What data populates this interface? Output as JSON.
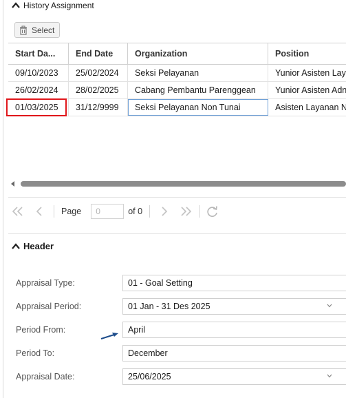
{
  "history": {
    "title": "History Assignment",
    "select_label": "Select",
    "columns": [
      "Start Da...",
      "End Date",
      "Organization",
      "Position"
    ],
    "rows": [
      [
        "09/10/2023",
        "25/02/2024",
        "Seksi Pelayanan",
        "Yunior Asisten Lay"
      ],
      [
        "26/02/2024",
        "28/02/2025",
        "Cabang Pembantu Parenggean",
        "Yunior Asisten Adn"
      ],
      [
        "01/03/2025",
        "31/12/9999",
        "Seksi Pelayanan Non Tunai",
        "Asisten Layanan N"
      ]
    ],
    "pager": {
      "page_label": "Page",
      "page_value": "0",
      "of_label": "of 0"
    }
  },
  "header": {
    "title": "Header",
    "fields": [
      {
        "label": "Appraisal Type:",
        "value": "01 - Goal Setting"
      },
      {
        "label": "Appraisal Period:",
        "value": "01 Jan - 31 Des 2025"
      },
      {
        "label": "Period From:",
        "value": "April"
      },
      {
        "label": "Period To:",
        "value": "December"
      },
      {
        "label": "Appraisal Date:",
        "value": "25/06/2025"
      }
    ]
  },
  "icons": {
    "collapse": "chevron-up-icon",
    "trash": "trash-icon",
    "first": "first-page-icon",
    "prev": "prev-page-icon",
    "next": "next-page-icon",
    "last": "last-page-icon",
    "refresh": "refresh-icon",
    "dropdown": "chevron-down-icon"
  },
  "colors": {
    "highlight": "#e0161b",
    "annotation_arrow": "#1f4e8c",
    "selected_cell_border": "#6fa0d6"
  }
}
